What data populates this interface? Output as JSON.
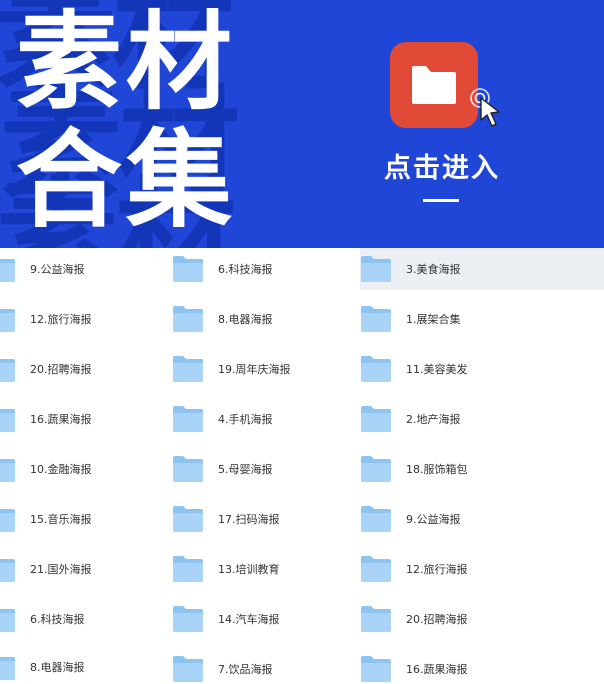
{
  "banner": {
    "title_line1": "素材",
    "title_line2": "合集",
    "ghost_text": "素材",
    "cta_label": "点击进入",
    "tile_color": "#e04a36",
    "background_color": "#1f46d6"
  },
  "files": {
    "columns": [
      [
        "9.公益海报",
        "12.旅行海报",
        "20.招聘海报",
        "16.蔬果海报",
        "10.金融海报",
        "15.音乐海报",
        "21.国外海报",
        "6.科技海报",
        "8.电器海报"
      ],
      [
        "6.科技海报",
        "8.电器海报",
        "19.周年庆海报",
        "4.手机海报",
        "5.母婴海报",
        "17.扫码海报",
        "13.培训教育",
        "14.汽车海报",
        "7.饮品海报"
      ],
      [
        "3.美食海报",
        "1.展架合集",
        "11.美容美发",
        "2.地产海报",
        "18.服饰箱包",
        "9.公益海报",
        "12.旅行海报",
        "20.招聘海报",
        "16.蔬果海报"
      ]
    ],
    "selected": "3.美食海报",
    "folder_color": "#a9d4f7"
  }
}
